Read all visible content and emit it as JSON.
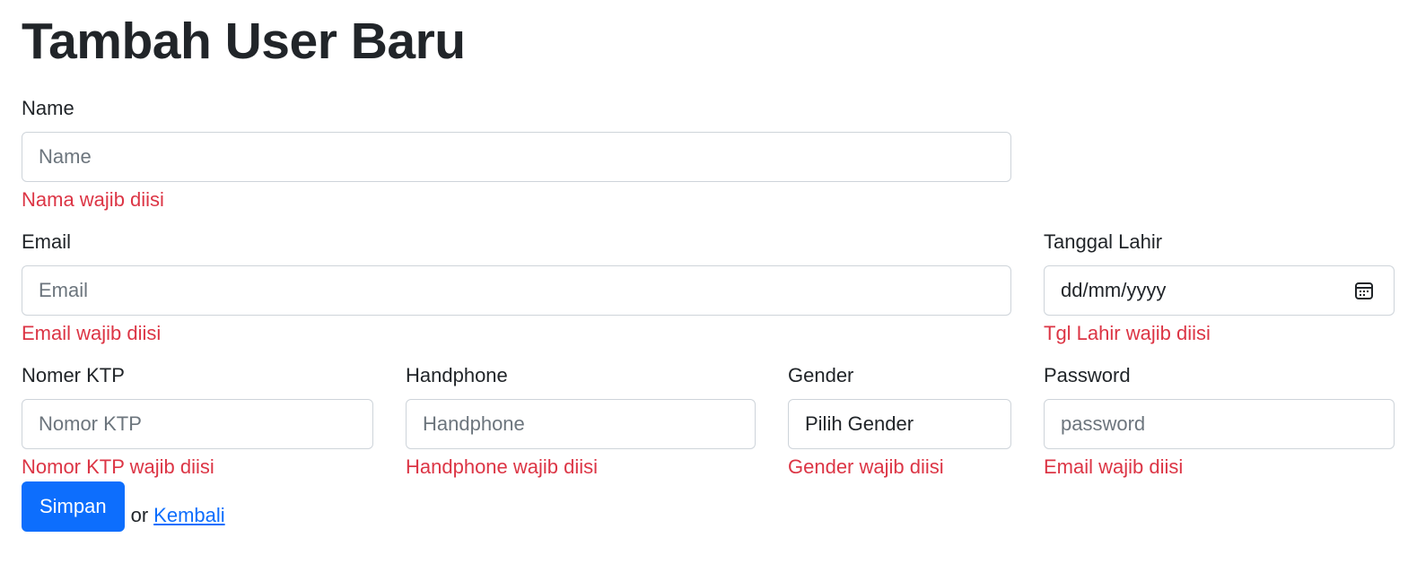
{
  "page": {
    "title": "Tambah User Baru"
  },
  "form": {
    "name": {
      "label": "Name",
      "placeholder": "Name",
      "value": "",
      "error": "Nama wajib diisi"
    },
    "email": {
      "label": "Email",
      "placeholder": "Email",
      "value": "",
      "error": "Email wajib diisi"
    },
    "birth_date": {
      "label": "Tanggal Lahir",
      "display_value": "dd/mm/yyyy",
      "icon": "calendar-icon",
      "error": "Tgl Lahir wajib diisi"
    },
    "ktp": {
      "label": "Nomer KTP",
      "placeholder": "Nomor KTP",
      "value": "",
      "error": "Nomor KTP wajib diisi"
    },
    "handphone": {
      "label": "Handphone",
      "placeholder": "Handphone",
      "value": "",
      "error": "Handphone wajib diisi"
    },
    "gender": {
      "label": "Gender",
      "selected": "Pilih Gender",
      "error": "Gender wajib diisi"
    },
    "password": {
      "label": "Password",
      "placeholder": "password",
      "value": "",
      "error": "Email wajib diisi"
    }
  },
  "actions": {
    "submit_label": "Simpan",
    "or_text": "or",
    "back_label": "Kembali"
  },
  "colors": {
    "primary": "#0d6efd",
    "error": "#dc3545",
    "border": "#ced4da",
    "text": "#212529",
    "placeholder": "#6c757d"
  }
}
